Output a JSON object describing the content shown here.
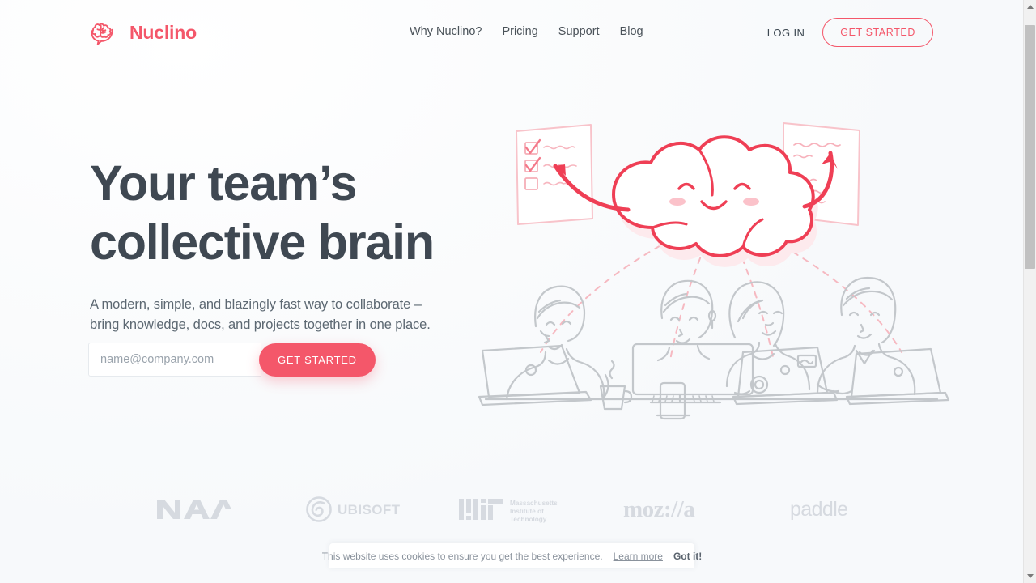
{
  "brand": {
    "name": "Nuclino",
    "logo_icon": "brain-speech-bubble-icon",
    "accent_color": "#f4576a"
  },
  "header": {
    "nav": [
      {
        "label": "Why Nuclino?"
      },
      {
        "label": "Pricing"
      },
      {
        "label": "Support"
      },
      {
        "label": "Blog"
      }
    ],
    "login_label": "LOG IN",
    "cta_label": "GET STARTED"
  },
  "hero": {
    "title_line1": "Your team’s",
    "title_line2": "collective brain",
    "subtitle_line1": "A modern, simple, and blazingly fast way to collaborate –",
    "subtitle_line2": "bring knowledge, docs, and projects together in one place.",
    "email_placeholder": "name@company.com",
    "email_value": "",
    "cta_label": "GET STARTED",
    "title_color": "#3f4852",
    "illustration_name": "team-collective-brain-illustration"
  },
  "logos": [
    {
      "name": "nasa-logo",
      "text": "NASA"
    },
    {
      "name": "ubisoft-logo",
      "text": "UBISOFT"
    },
    {
      "name": "mit-logo",
      "text": "Massachusetts Institute of Technology"
    },
    {
      "name": "mozilla-logo",
      "text": "moz://a"
    },
    {
      "name": "paddle-logo",
      "text": "paddle"
    }
  ],
  "cookie": {
    "message": "This website uses cookies to ensure you get the best experience.",
    "learn_more_label": "Learn more",
    "accept_label": "Got it!"
  },
  "scrollbar": {
    "up_icon": "caret-up-icon",
    "down_icon": "caret-down-icon",
    "thumb_name": "scrollbar-thumb"
  }
}
